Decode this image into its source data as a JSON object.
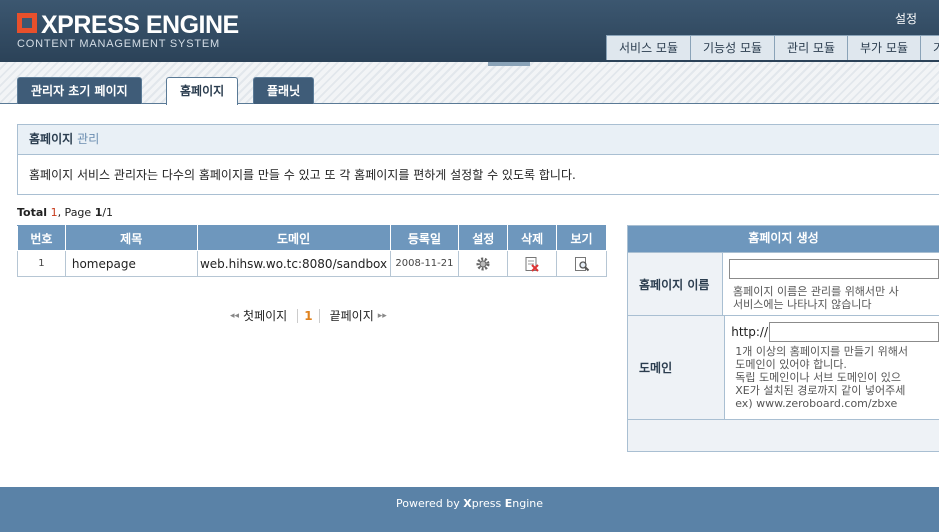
{
  "header": {
    "logo_title": "XPRESS ENGINE",
    "logo_sub": "CONTENT MANAGEMENT SYSTEM",
    "settings": "설정",
    "menu": [
      "서비스 모듈",
      "기능성 모듈",
      "관리 모듈",
      "부가 모듈",
      "기"
    ]
  },
  "tabs": [
    {
      "label": "관리자 초기 페이지",
      "active": false
    },
    {
      "label": "홈페이지",
      "active": true
    },
    {
      "label": "플래닛",
      "active": false
    }
  ],
  "intro": {
    "title": "홈페이지",
    "subtitle": "관리",
    "description": "홈페이지 서비스 관리자는 다수의 홈페이지를 만들 수 있고 또 각 홈페이지를 편하게 설정할 수 있도록 합니다."
  },
  "summary": {
    "total_label": "Total",
    "total": "1",
    "page_label": ", Page",
    "page": "1",
    "page_total": "/1"
  },
  "table": {
    "headers": [
      "번호",
      "제목",
      "도메인",
      "등록일",
      "설정",
      "삭제",
      "보기"
    ],
    "rows": [
      {
        "no": "1",
        "title": "homepage",
        "domain": "web.hihsw.wo.tc:8080/sandbox",
        "date": "2008-11-21"
      }
    ]
  },
  "pager": {
    "first": "첫페이지",
    "current": "1",
    "last": "끝페이지"
  },
  "create": {
    "title": "홈페이지 생성",
    "name_label": "홈페이지 이름",
    "name_help": [
      "홈페이지 이름은 관리를 위해서만 사",
      "서비스에는 나타나지 않습니다"
    ],
    "domain_label": "도메인",
    "domain_prefix": "http://",
    "domain_help": [
      "1개 이상의 홈페이지를 만들기 위해서",
      "도메인이 있어야 합니다.",
      "독립 도메인이나 서브 도메인이 있으",
      "XE가 설치된 경로까지 같이 넣어주세",
      "ex) www.zeroboard.com/zbxe"
    ]
  },
  "footer": {
    "powered": "Powered by ",
    "brand_x": "X",
    "brand_press": "press ",
    "brand_e": "E",
    "brand_ngine": "ngine"
  },
  "colors": {
    "header": "#3c5770",
    "accent": "#e8502c",
    "table_head": "#6e97bd",
    "footer": "#5a82a7"
  }
}
